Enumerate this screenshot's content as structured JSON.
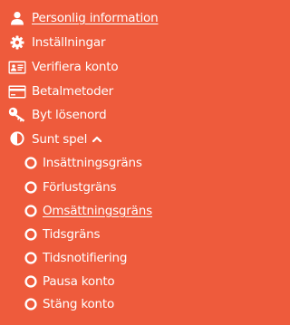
{
  "colors": {
    "background": "#EE5B3C",
    "foreground": "#FFFFFF"
  },
  "menu": {
    "items": [
      {
        "label": "Personlig information",
        "icon": "user-icon",
        "active": true
      },
      {
        "label": "Inställningar",
        "icon": "gear-icon",
        "active": false
      },
      {
        "label": "Verifiera konto",
        "icon": "id-card-icon",
        "active": false
      },
      {
        "label": "Betalmetoder",
        "icon": "credit-card-icon",
        "active": false
      },
      {
        "label": "Byt lösenord",
        "icon": "key-icon",
        "active": false
      },
      {
        "label": "Sunt spel",
        "icon": "half-circle-icon",
        "expanded": true,
        "caret_icon": "chevron-up-icon"
      }
    ],
    "sunt_spel_items": [
      {
        "label": "Insättningsgräns",
        "icon": "circle-icon",
        "active": false
      },
      {
        "label": "Förlustgräns",
        "icon": "circle-icon",
        "active": false
      },
      {
        "label": "Omsättningsgräns",
        "icon": "circle-icon",
        "active": true
      },
      {
        "label": "Tidsgräns",
        "icon": "circle-icon",
        "active": false
      },
      {
        "label": "Tidsnotifiering",
        "icon": "circle-icon",
        "active": false
      },
      {
        "label": "Pausa konto",
        "icon": "circle-icon",
        "active": false
      },
      {
        "label": "Stäng konto",
        "icon": "circle-icon",
        "active": false
      }
    ]
  }
}
